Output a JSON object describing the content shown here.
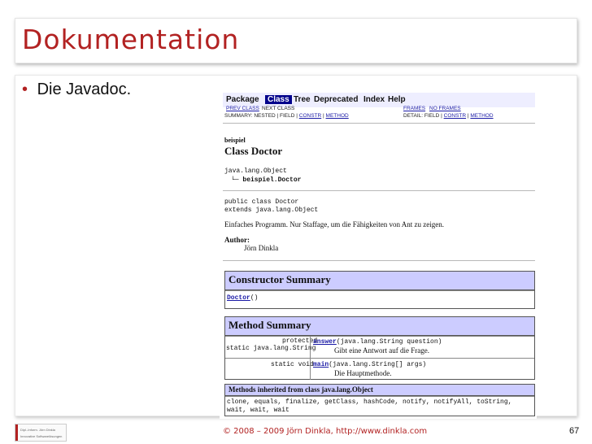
{
  "slide": {
    "title": "Dokumentation",
    "bullet": "Die Javadoc.",
    "footer": "© 2008 – 2009 Jörn Dinkla, http://www.dinkla.com",
    "page_number": "67",
    "logo_line1": "Dipl.-Inform. Jörn Dinkla",
    "logo_line2": "Innovative Softwarelösungen",
    "accent_color": "#b22222"
  },
  "javadoc": {
    "nav": {
      "package": "Package",
      "class": "Class",
      "tree": "Tree",
      "deprecated": "Deprecated",
      "index": "Index",
      "help": "Help"
    },
    "subnav": {
      "prev_class": "PREV CLASS",
      "next_class": "NEXT CLASS",
      "frames": "FRAMES",
      "no_frames": "NO FRAMES",
      "summary_label": "SUMMARY: NESTED | FIELD |",
      "summary_constr": "CONSTR",
      "summary_method": "METHOD",
      "detail_label": "DETAIL: FIELD |",
      "detail_constr": "CONSTR",
      "detail_method": "METHOD"
    },
    "package_name": "beispiel",
    "class_title": "Class Doctor",
    "hierarchy_root": "java.lang.Object",
    "hierarchy_child": "└─ beispiel.Doctor",
    "decl_line1": "public class Doctor",
    "decl_line2": "extends java.lang.Object",
    "description": "Einfaches Programm. Nur Staffage, um die Fähigkeiten von Ant zu zeigen.",
    "author_label": "Author:",
    "author_name": "Jörn Dinkla",
    "constructor_summary": {
      "heading": "Constructor Summary",
      "name": "Doctor",
      "params": "()"
    },
    "method_summary": {
      "heading": "Method Summary",
      "rows": [
        {
          "modifier1": "protected",
          "modifier2": "static java.lang.String",
          "name": "answer",
          "params": "(java.lang.String question)",
          "desc": "Gibt eine Antwort auf die Frage."
        },
        {
          "modifier1": "static void",
          "modifier2": "",
          "name": "main",
          "params": "(java.lang.String[] args)",
          "desc": "Die Hauptmethode."
        }
      ]
    },
    "inherited": {
      "heading": "Methods inherited from class java.lang.Object",
      "line1": "clone, equals, finalize, getClass, hashCode, notify, notifyAll, toString,",
      "line2": "wait, wait, wait"
    }
  }
}
